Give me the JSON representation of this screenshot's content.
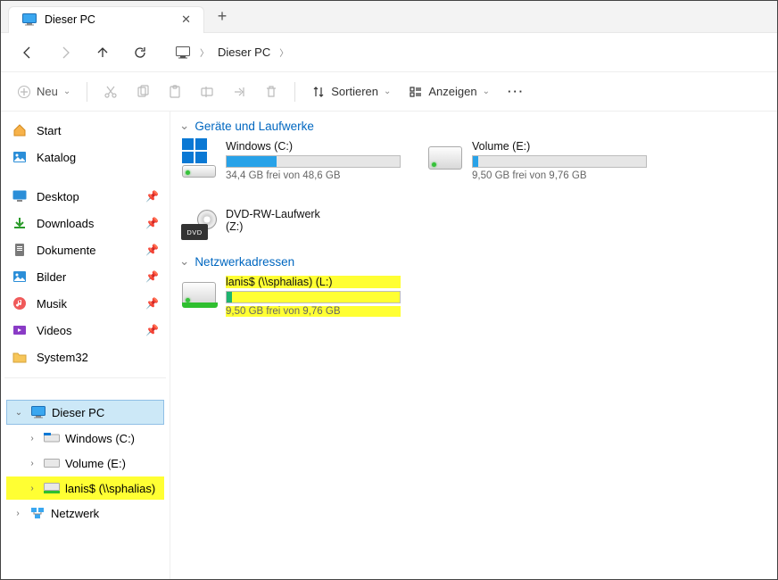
{
  "tab": {
    "title": "Dieser PC"
  },
  "breadcrumb": {
    "item1": "Dieser PC"
  },
  "toolbar": {
    "new": "Neu",
    "sort": "Sortieren",
    "view": "Anzeigen"
  },
  "sidebar": {
    "start": "Start",
    "katalog": "Katalog",
    "desktop": "Desktop",
    "downloads": "Downloads",
    "dokumente": "Dokumente",
    "bilder": "Bilder",
    "musik": "Musik",
    "videos": "Videos",
    "system32": "System32"
  },
  "tree": {
    "thispc": "Dieser PC",
    "winc": "Windows (C:)",
    "vole": "Volume (E:)",
    "lanis": "lanis$ (\\\\sphalias)",
    "netzwerk": "Netzwerk"
  },
  "groups": {
    "drives": "Geräte und Laufwerke",
    "network": "Netzwerkadressen"
  },
  "drive_c": {
    "name": "Windows (C:)",
    "sub": "34,4 GB frei von 48,6 GB",
    "pct": 29
  },
  "drive_e": {
    "name": "Volume (E:)",
    "sub": "9,50 GB frei von 9,76 GB",
    "pct": 3
  },
  "drive_z": {
    "name": "DVD-RW-Laufwerk (Z:)"
  },
  "drive_l": {
    "name": "lanis$ (\\\\sphalias) (L:)",
    "sub": "9,50 GB frei von 9,76 GB",
    "pct": 3
  }
}
